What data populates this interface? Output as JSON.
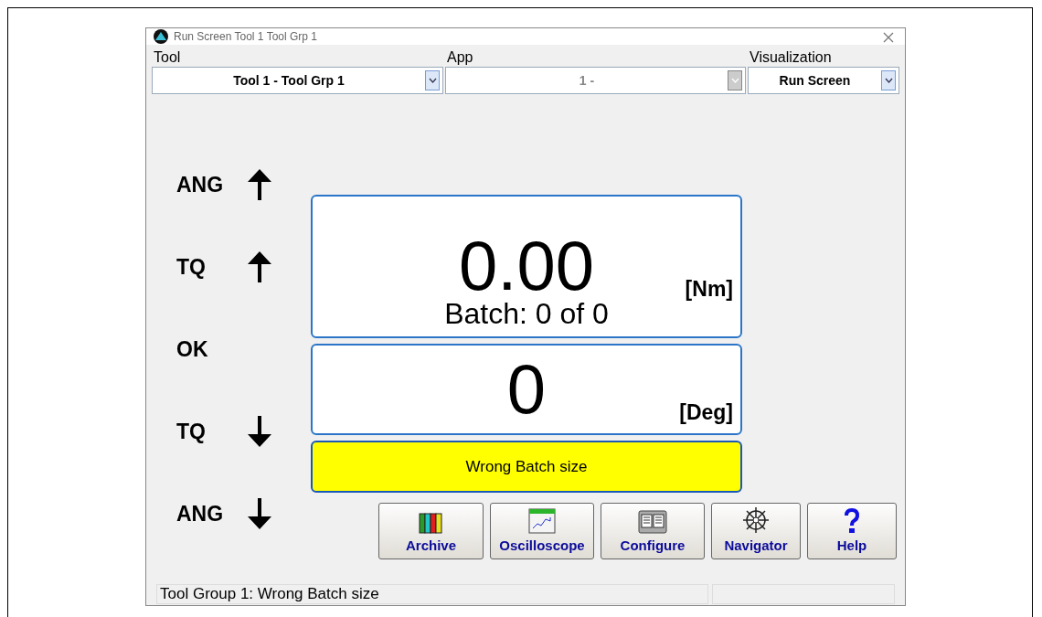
{
  "window": {
    "title": "Run Screen  Tool 1  Tool Grp 1"
  },
  "selectors": [
    {
      "label": "Tool",
      "value": "Tool  1 - Tool Grp 1",
      "disabled": false
    },
    {
      "label": "App",
      "value": "1 -",
      "disabled": true
    },
    {
      "label": "Visualization",
      "value": "Run Screen",
      "disabled": false
    }
  ],
  "limits": [
    {
      "label": "ANG",
      "kind": "up"
    },
    {
      "label": "TQ",
      "kind": "up"
    },
    {
      "label": "OK",
      "kind": "none"
    },
    {
      "label": "TQ",
      "kind": "down"
    },
    {
      "label": "ANG",
      "kind": "down"
    }
  ],
  "torque": {
    "value": "0.00",
    "unit": "[Nm]",
    "batch": "Batch: 0 of 0"
  },
  "angle": {
    "value": "0",
    "unit": "[Deg]"
  },
  "message": {
    "text": "Wrong Batch size",
    "color": "#ffff00"
  },
  "buttons": [
    {
      "label": "Archive",
      "kind": "archive"
    },
    {
      "label": "Oscilloscope",
      "kind": "scope"
    },
    {
      "label": "Configure",
      "kind": "configure"
    },
    {
      "label": "Navigator",
      "kind": "navigator"
    },
    {
      "label": "Help",
      "kind": "help"
    }
  ],
  "status_bar": {
    "text": "Tool Group 1: Wrong Batch size"
  }
}
